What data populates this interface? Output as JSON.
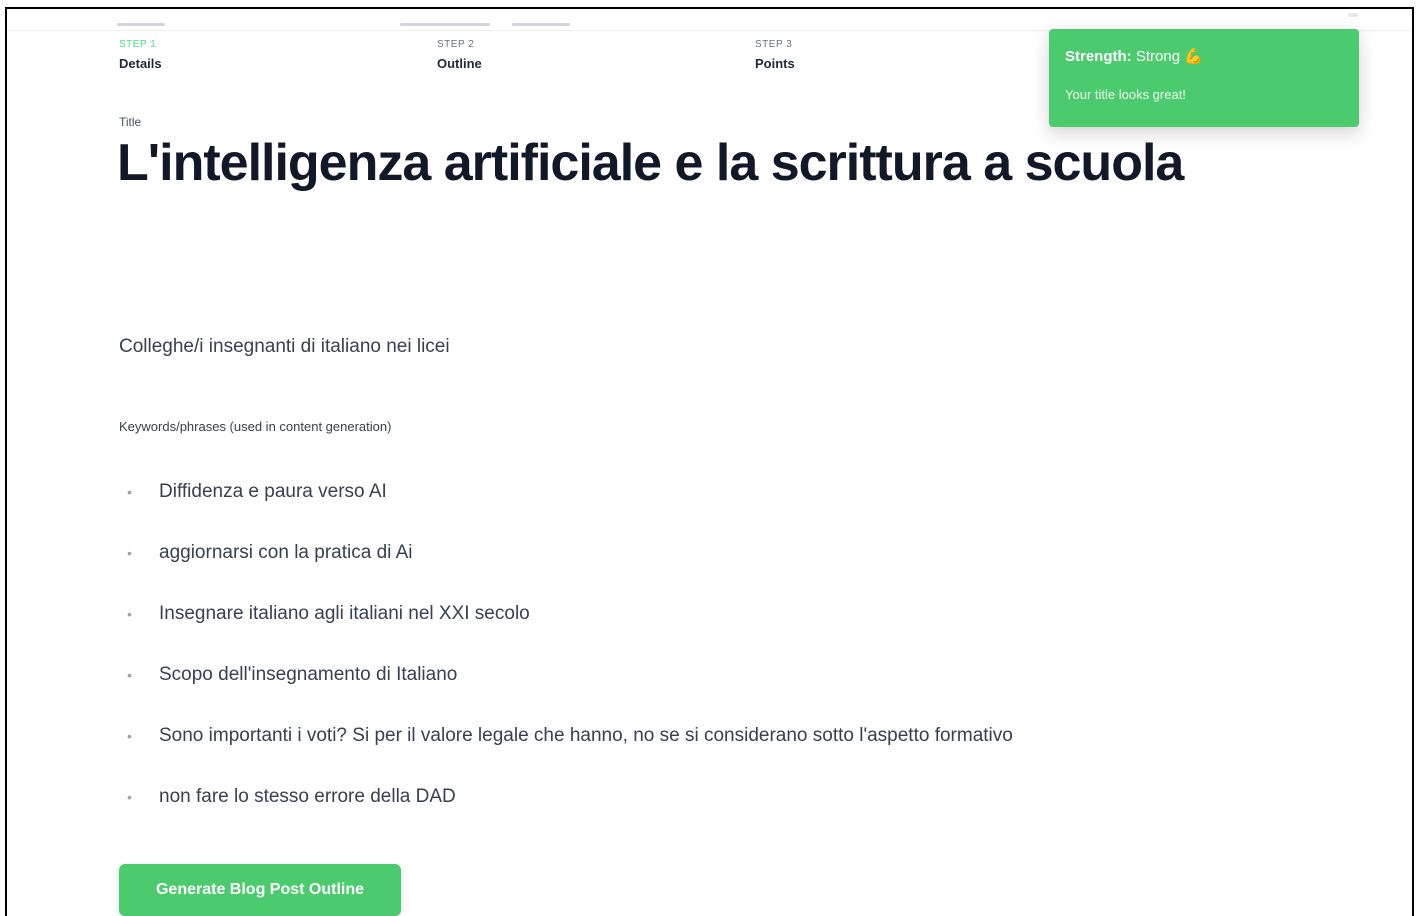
{
  "steps": [
    {
      "num": "STEP 1",
      "label": "Details"
    },
    {
      "num": "STEP 2",
      "label": "Outline"
    },
    {
      "num": "STEP 3",
      "label": "Points"
    }
  ],
  "toast": {
    "strength_label": "Strength:",
    "strength_value": "Strong",
    "strength_emoji": "💪",
    "message": "Your title looks great!"
  },
  "form": {
    "title_label": "Title",
    "title_value": "L'intelligenza artificiale e la scrittura a scuola",
    "audience_value": "Colleghe/i insegnanti di italiano nei licei",
    "keywords_label": "Keywords/phrases (used in content generation)",
    "keywords": [
      "Diffidenza e paura verso AI",
      "aggiornarsi con la pratica di Ai",
      "Insegnare italiano agli italiani nel XXI secolo",
      "Scopo dell'insegnamento di Italiano",
      "Sono importanti i voti? Si per il valore legale che hanno, no se si considerano sotto l'aspetto formativo",
      "non fare lo stesso errore della DAD"
    ],
    "bullet_glyph": "•",
    "generate_button": "Generate Blog Post Outline"
  },
  "colors": {
    "accent": "#4ccb6e",
    "active_step": "#4ade80",
    "text": "#111827"
  }
}
